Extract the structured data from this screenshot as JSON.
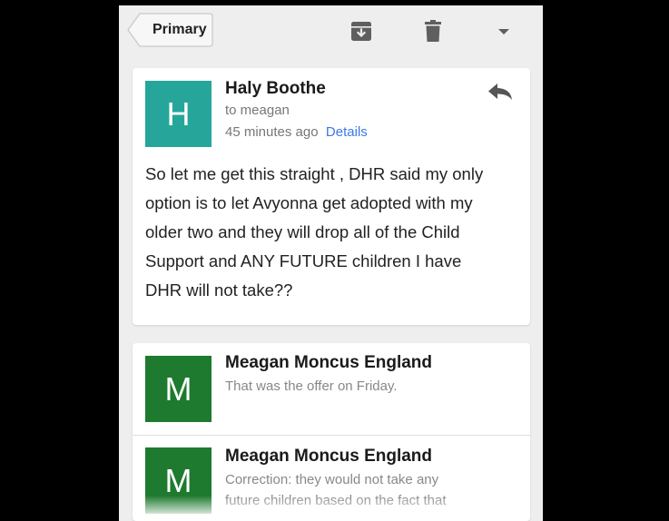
{
  "toolbar": {
    "back_label": "Primary",
    "icons": [
      "archive-icon",
      "trash-icon",
      "dropdown-icon"
    ]
  },
  "messages": [
    {
      "avatar_letter": "H",
      "avatar_color": "#26a69a",
      "sender": "Haly Boothe",
      "to": "to meagan",
      "time": "45 minutes ago",
      "details_label": "Details",
      "body_lines": [
        "So let me get this straight , DHR said my only",
        "option is to let Avyonna get adopted with my",
        "older two and they will drop all of the Child",
        "Support and ANY FUTURE children I have",
        "DHR will not take??"
      ]
    },
    {
      "avatar_letter": "M",
      "avatar_color": "#1e7a2e",
      "sender": "Meagan Moncus England",
      "snippet_lines": [
        "That was the offer on Friday."
      ]
    },
    {
      "avatar_letter": "M",
      "avatar_color": "#1e7a2e",
      "sender": "Meagan Moncus England",
      "snippet_lines": [
        "Correction: they would not take any",
        "future children based on the fact that"
      ]
    }
  ],
  "colors": {
    "background": "#000000",
    "screen": "#eeeeee",
    "link": "#3b78e7",
    "icon": "#5f5f5f"
  }
}
